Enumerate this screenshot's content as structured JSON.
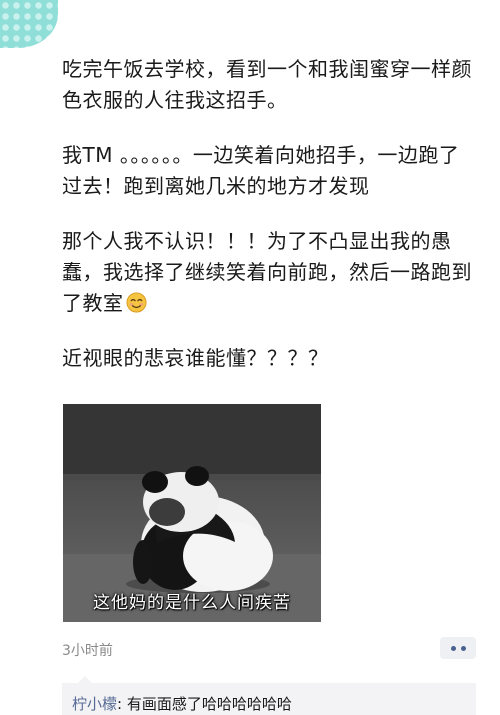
{
  "post": {
    "paragraphs": [
      "吃完午饭去学校，看到一个和我闺蜜穿一样颜色衣服的人往我这招手。",
      "我TM 。。。。。。一边笑着向她招手，一边跑了过去！跑到离她几米的地方才发现",
      "那个人我不认识！！！为了不凸显出我的愚蠢，我选择了继续笑着向前跑，然后一路跑到了教室",
      "近视眼的悲哀谁能懂？？？？"
    ],
    "emoji": "smiling-blush-emoji"
  },
  "meme": {
    "caption": "这他妈的是什么人间疾苦",
    "subject": "panda"
  },
  "meta": {
    "time_ago": "3小时前"
  },
  "comment": {
    "author": "柠小檬",
    "separator": ": ",
    "text": "有画面感了哈哈哈哈哈哈"
  },
  "colors": {
    "corner_pattern": "#8fded8",
    "author_link": "#576b95",
    "more_button_dots": "#4a6190"
  }
}
